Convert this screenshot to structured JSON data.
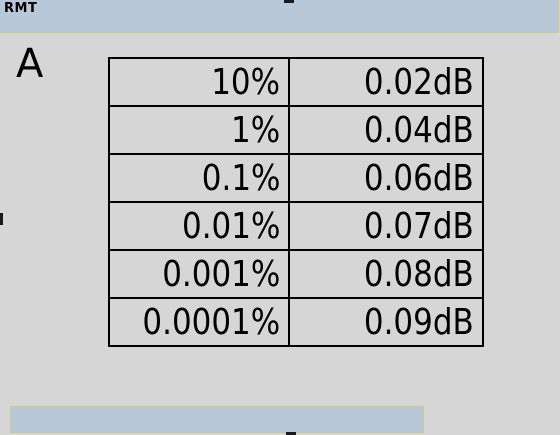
{
  "header": {
    "title": "RMT"
  },
  "trace": {
    "label": "A"
  },
  "table": {
    "rows": [
      {
        "probability": "10%",
        "level": "0.02dB"
      },
      {
        "probability": "1%",
        "level": "0.04dB"
      },
      {
        "probability": "0.1%",
        "level": "0.06dB"
      },
      {
        "probability": "0.01%",
        "level": "0.07dB"
      },
      {
        "probability": "0.001%",
        "level": "0.08dB"
      },
      {
        "probability": "0.0001%",
        "level": "0.09dB"
      }
    ]
  },
  "colors": {
    "background": "#d6d6d6",
    "bar": "#b8c8d8",
    "bar_border": "#c9c98a",
    "text": "#000000"
  }
}
